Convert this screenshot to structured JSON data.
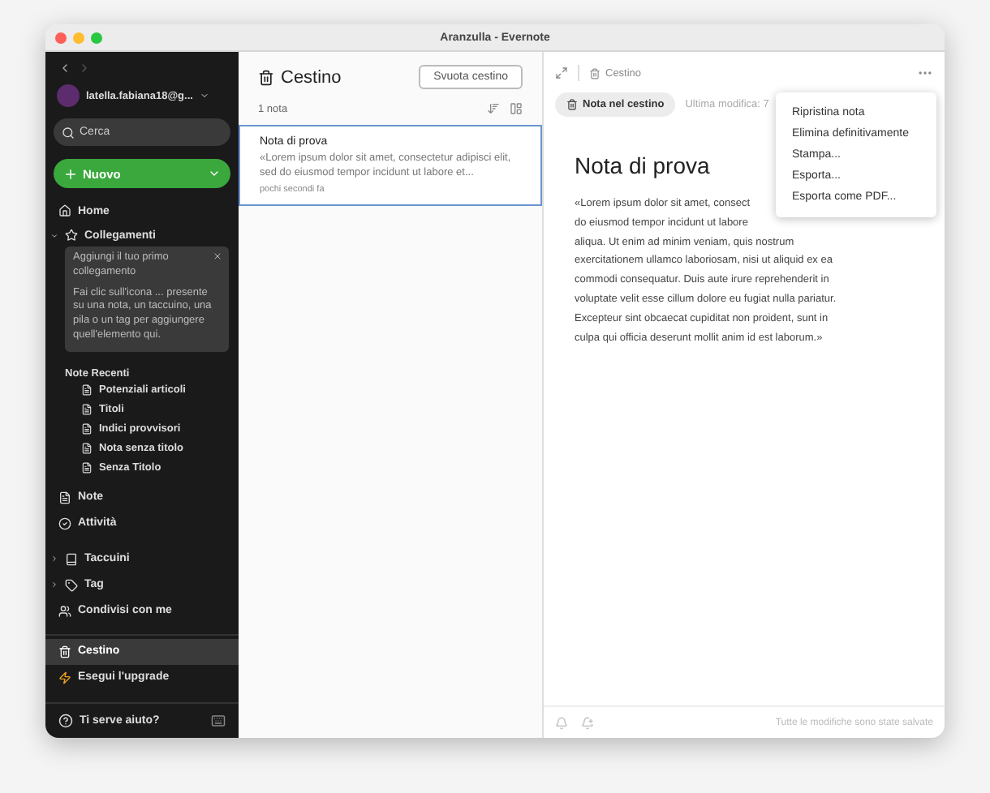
{
  "window": {
    "title": "Aranzulla - Evernote"
  },
  "sidebar": {
    "account": "latella.fabiana18@g...",
    "search": {
      "placeholder": "Cerca"
    },
    "new_button": "Nuovo",
    "home": {
      "label": "Home",
      "selected": false
    },
    "shortcuts": {
      "label": "Collegamenti",
      "expanded": true,
      "card_title": "Aggiungi il tuo primo collegamento",
      "card_text": "Fai clic sull'icona ... presente su una nota, un taccuino, una pila o un tag per aggiungere quell'elemento qui."
    },
    "recent": {
      "label": "Note Recenti",
      "items": [
        "Potenziali articoli",
        "Titoli",
        "Indici provvisori",
        "Nota senza titolo",
        "Senza Titolo"
      ]
    },
    "items": [
      {
        "label": "Note",
        "kind": "notes",
        "selected": false
      },
      {
        "label": "Attività",
        "kind": "tasks",
        "selected": false
      },
      {
        "label": "Taccuini",
        "kind": "notebooks",
        "selected": false,
        "expanded": false
      },
      {
        "label": "Tag",
        "kind": "tags",
        "selected": false,
        "expanded": false
      },
      {
        "label": "Condivisi con me",
        "kind": "shared",
        "selected": false
      }
    ],
    "bottom": [
      {
        "label": "Cestino",
        "kind": "trash",
        "selected": true
      },
      {
        "label": "Esegui l'upgrade",
        "kind": "upgrade",
        "selected": false
      }
    ],
    "help": "Ti serve aiuto?"
  },
  "list": {
    "title": "Cestino",
    "button": "Svuota cestino",
    "count": "1 nota",
    "notes": [
      {
        "title": "Nota di prova",
        "snippet": "«Lorem ipsum dolor sit amet, consectetur adipisci elit, sed do eiusmod tempor incidunt ut labore et...",
        "time": "pochi secondi fa",
        "selected": true
      }
    ]
  },
  "editor": {
    "breadcrumb": "Cestino",
    "badge": "Nota nel cestino",
    "meta": "Ultima modifica: 7",
    "menu": [
      "Ripristina nota",
      "Elimina definitivamente",
      "Stampa...",
      "Esporta...",
      "Esporta come PDF..."
    ],
    "title": "Nota di prova",
    "body_lines": [
      "«Lorem ipsum dolor sit amet, consect",
      "do eiusmod tempor incidunt ut labore",
      "aliqua. Ut enim ad minim veniam, quis nostrum",
      "exercitationem ullamco laboriosam, nisi ut aliquid ex ea",
      "commodi consequatur. Duis aute irure reprehenderit in",
      "voluptate velit esse cillum dolore eu fugiat nulla pariatur.",
      "Excepteur sint obcaecat cupiditat non proident, sunt in",
      "culpa qui officia deserunt mollit anim id est laborum.»"
    ],
    "status": "Tutte le modifiche sono state salvate"
  }
}
